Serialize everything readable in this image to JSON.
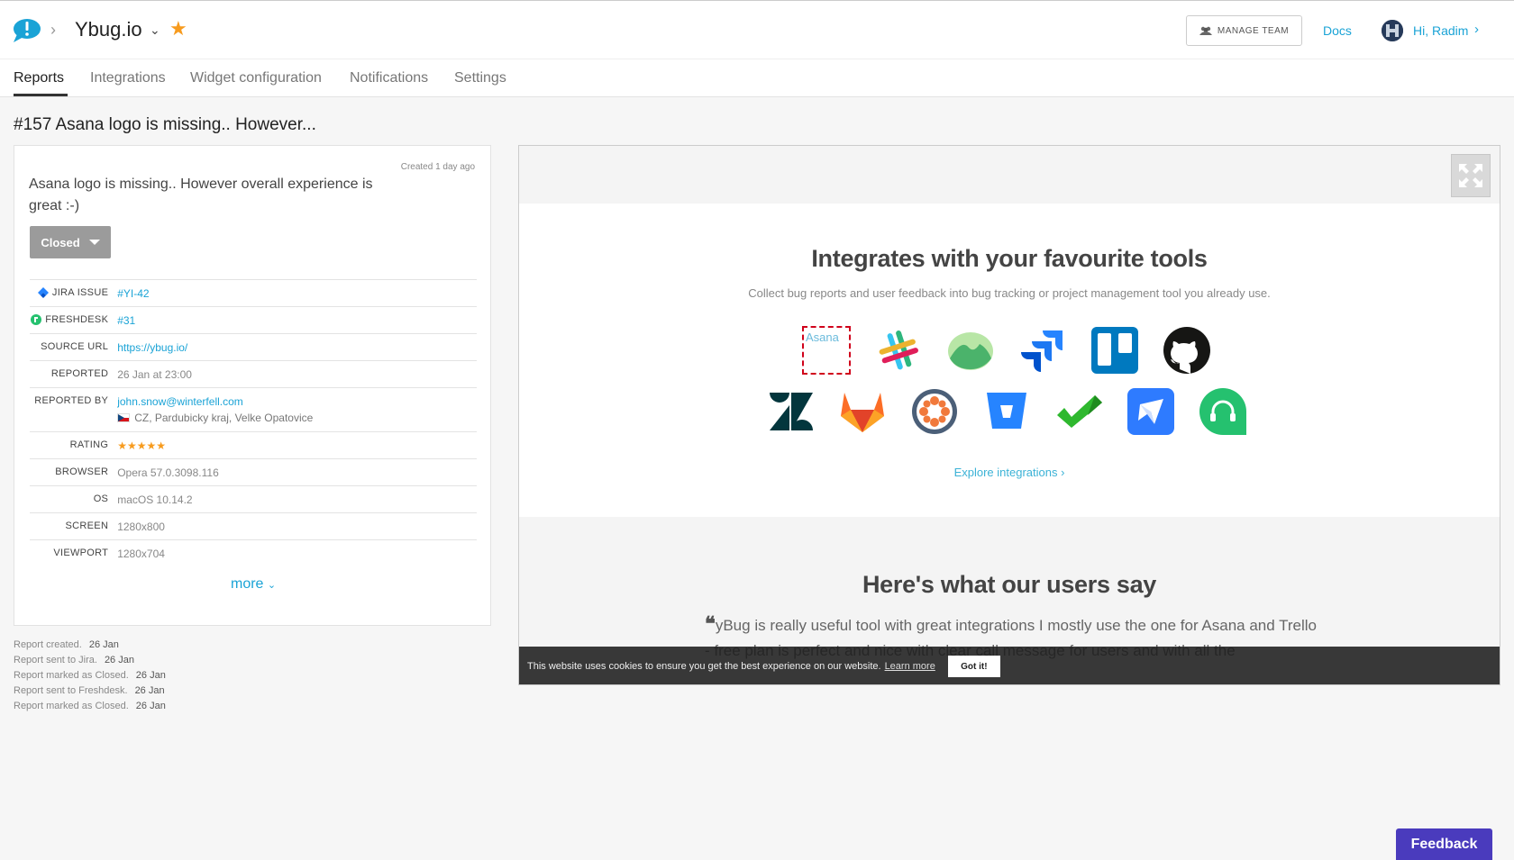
{
  "header": {
    "project_name": "Ybug.io",
    "manage_team_label": "MANAGE TEAM",
    "docs_label": "Docs",
    "user_greeting": "Hi, Radim"
  },
  "tabs": [
    {
      "label": "Reports",
      "active": true
    },
    {
      "label": "Integrations",
      "active": false
    },
    {
      "label": "Widget configuration",
      "active": false
    },
    {
      "label": "Notifications",
      "active": false
    },
    {
      "label": "Settings",
      "active": false
    }
  ],
  "report": {
    "title": "#157 Asana logo is missing.. However...",
    "created": "Created 1 day ago",
    "description": "Asana logo is missing.. However overall experience is great :-)",
    "status": "Closed",
    "fields": {
      "jira_label": "JIRA ISSUE",
      "jira_value": "#YI-42",
      "freshdesk_label": "FRESHDESK",
      "freshdesk_value": "#31",
      "source_label": "SOURCE URL",
      "source_value": "https://ybug.io/",
      "reported_label": "REPORTED",
      "reported_value": "26 Jan at 23:00",
      "reported_by_label": "REPORTED BY",
      "reported_by_value": "john.snow@winterfell.com",
      "location_value": "CZ, Pardubicky kraj, Velke Opatovice",
      "rating_label": "RATING",
      "rating_stars": "★★★★★",
      "rating_value": 5,
      "browser_label": "BROWSER",
      "browser_value": "Opera 57.0.3098.116",
      "os_label": "OS",
      "os_value": "macOS 10.14.2",
      "screen_label": "SCREEN",
      "screen_value": "1280x800",
      "viewport_label": "VIEWPORT",
      "viewport_value": "1280x704"
    },
    "more_label": "more"
  },
  "activity": [
    {
      "text": "Report created.",
      "date": "26 Jan"
    },
    {
      "text": "Report sent to Jira.",
      "date": "26 Jan"
    },
    {
      "text": "Report marked as Closed.",
      "date": "26 Jan"
    },
    {
      "text": "Report sent to Freshdesk.",
      "date": "26 Jan"
    },
    {
      "text": "Report marked as Closed.",
      "date": "26 Jan"
    }
  ],
  "screenshot": {
    "integrations_title": "Integrates with your favourite tools",
    "integrations_subtitle": "Collect bug reports and user feedback into bug tracking or project management tool you already use.",
    "asana_alt": "Asana",
    "explore_label": "Explore integrations",
    "users_title": "Here's what our users say",
    "quote_text": "yBug is really useful tool with great integrations I mostly use the one for Asana and Trello - free plan is perfect and nice with clear call message for users and with all the",
    "cookie_text": "This website uses cookies to ensure you get the best experience on our website.",
    "cookie_learn": "Learn more",
    "cookie_button": "Got it!"
  },
  "feedback_label": "Feedback",
  "colors": {
    "accent": "#1aa3d6",
    "star": "#f79b1e",
    "feedback": "#4a3bbd",
    "status_button": "#9b9b9b"
  }
}
